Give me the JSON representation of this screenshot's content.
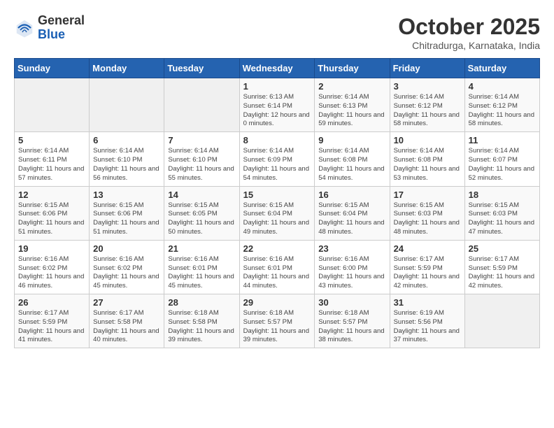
{
  "header": {
    "logo": {
      "general": "General",
      "blue": "Blue"
    },
    "title": "October 2025",
    "location": "Chitradurga, Karnataka, India"
  },
  "calendar": {
    "headers": [
      "Sunday",
      "Monday",
      "Tuesday",
      "Wednesday",
      "Thursday",
      "Friday",
      "Saturday"
    ],
    "weeks": [
      [
        {
          "day": "",
          "sunrise": "",
          "sunset": "",
          "daylight": "",
          "empty": true
        },
        {
          "day": "",
          "sunrise": "",
          "sunset": "",
          "daylight": "",
          "empty": true
        },
        {
          "day": "",
          "sunrise": "",
          "sunset": "",
          "daylight": "",
          "empty": true
        },
        {
          "day": "1",
          "sunrise": "Sunrise: 6:13 AM",
          "sunset": "Sunset: 6:14 PM",
          "daylight": "Daylight: 12 hours and 0 minutes."
        },
        {
          "day": "2",
          "sunrise": "Sunrise: 6:14 AM",
          "sunset": "Sunset: 6:13 PM",
          "daylight": "Daylight: 11 hours and 59 minutes."
        },
        {
          "day": "3",
          "sunrise": "Sunrise: 6:14 AM",
          "sunset": "Sunset: 6:12 PM",
          "daylight": "Daylight: 11 hours and 58 minutes."
        },
        {
          "day": "4",
          "sunrise": "Sunrise: 6:14 AM",
          "sunset": "Sunset: 6:12 PM",
          "daylight": "Daylight: 11 hours and 58 minutes."
        }
      ],
      [
        {
          "day": "5",
          "sunrise": "Sunrise: 6:14 AM",
          "sunset": "Sunset: 6:11 PM",
          "daylight": "Daylight: 11 hours and 57 minutes."
        },
        {
          "day": "6",
          "sunrise": "Sunrise: 6:14 AM",
          "sunset": "Sunset: 6:10 PM",
          "daylight": "Daylight: 11 hours and 56 minutes."
        },
        {
          "day": "7",
          "sunrise": "Sunrise: 6:14 AM",
          "sunset": "Sunset: 6:10 PM",
          "daylight": "Daylight: 11 hours and 55 minutes."
        },
        {
          "day": "8",
          "sunrise": "Sunrise: 6:14 AM",
          "sunset": "Sunset: 6:09 PM",
          "daylight": "Daylight: 11 hours and 54 minutes."
        },
        {
          "day": "9",
          "sunrise": "Sunrise: 6:14 AM",
          "sunset": "Sunset: 6:08 PM",
          "daylight": "Daylight: 11 hours and 54 minutes."
        },
        {
          "day": "10",
          "sunrise": "Sunrise: 6:14 AM",
          "sunset": "Sunset: 6:08 PM",
          "daylight": "Daylight: 11 hours and 53 minutes."
        },
        {
          "day": "11",
          "sunrise": "Sunrise: 6:14 AM",
          "sunset": "Sunset: 6:07 PM",
          "daylight": "Daylight: 11 hours and 52 minutes."
        }
      ],
      [
        {
          "day": "12",
          "sunrise": "Sunrise: 6:15 AM",
          "sunset": "Sunset: 6:06 PM",
          "daylight": "Daylight: 11 hours and 51 minutes."
        },
        {
          "day": "13",
          "sunrise": "Sunrise: 6:15 AM",
          "sunset": "Sunset: 6:06 PM",
          "daylight": "Daylight: 11 hours and 51 minutes."
        },
        {
          "day": "14",
          "sunrise": "Sunrise: 6:15 AM",
          "sunset": "Sunset: 6:05 PM",
          "daylight": "Daylight: 11 hours and 50 minutes."
        },
        {
          "day": "15",
          "sunrise": "Sunrise: 6:15 AM",
          "sunset": "Sunset: 6:04 PM",
          "daylight": "Daylight: 11 hours and 49 minutes."
        },
        {
          "day": "16",
          "sunrise": "Sunrise: 6:15 AM",
          "sunset": "Sunset: 6:04 PM",
          "daylight": "Daylight: 11 hours and 48 minutes."
        },
        {
          "day": "17",
          "sunrise": "Sunrise: 6:15 AM",
          "sunset": "Sunset: 6:03 PM",
          "daylight": "Daylight: 11 hours and 48 minutes."
        },
        {
          "day": "18",
          "sunrise": "Sunrise: 6:15 AM",
          "sunset": "Sunset: 6:03 PM",
          "daylight": "Daylight: 11 hours and 47 minutes."
        }
      ],
      [
        {
          "day": "19",
          "sunrise": "Sunrise: 6:16 AM",
          "sunset": "Sunset: 6:02 PM",
          "daylight": "Daylight: 11 hours and 46 minutes."
        },
        {
          "day": "20",
          "sunrise": "Sunrise: 6:16 AM",
          "sunset": "Sunset: 6:02 PM",
          "daylight": "Daylight: 11 hours and 45 minutes."
        },
        {
          "day": "21",
          "sunrise": "Sunrise: 6:16 AM",
          "sunset": "Sunset: 6:01 PM",
          "daylight": "Daylight: 11 hours and 45 minutes."
        },
        {
          "day": "22",
          "sunrise": "Sunrise: 6:16 AM",
          "sunset": "Sunset: 6:01 PM",
          "daylight": "Daylight: 11 hours and 44 minutes."
        },
        {
          "day": "23",
          "sunrise": "Sunrise: 6:16 AM",
          "sunset": "Sunset: 6:00 PM",
          "daylight": "Daylight: 11 hours and 43 minutes."
        },
        {
          "day": "24",
          "sunrise": "Sunrise: 6:17 AM",
          "sunset": "Sunset: 5:59 PM",
          "daylight": "Daylight: 11 hours and 42 minutes."
        },
        {
          "day": "25",
          "sunrise": "Sunrise: 6:17 AM",
          "sunset": "Sunset: 5:59 PM",
          "daylight": "Daylight: 11 hours and 42 minutes."
        }
      ],
      [
        {
          "day": "26",
          "sunrise": "Sunrise: 6:17 AM",
          "sunset": "Sunset: 5:59 PM",
          "daylight": "Daylight: 11 hours and 41 minutes."
        },
        {
          "day": "27",
          "sunrise": "Sunrise: 6:17 AM",
          "sunset": "Sunset: 5:58 PM",
          "daylight": "Daylight: 11 hours and 40 minutes."
        },
        {
          "day": "28",
          "sunrise": "Sunrise: 6:18 AM",
          "sunset": "Sunset: 5:58 PM",
          "daylight": "Daylight: 11 hours and 39 minutes."
        },
        {
          "day": "29",
          "sunrise": "Sunrise: 6:18 AM",
          "sunset": "Sunset: 5:57 PM",
          "daylight": "Daylight: 11 hours and 39 minutes."
        },
        {
          "day": "30",
          "sunrise": "Sunrise: 6:18 AM",
          "sunset": "Sunset: 5:57 PM",
          "daylight": "Daylight: 11 hours and 38 minutes."
        },
        {
          "day": "31",
          "sunrise": "Sunrise: 6:19 AM",
          "sunset": "Sunset: 5:56 PM",
          "daylight": "Daylight: 11 hours and 37 minutes."
        },
        {
          "day": "",
          "sunrise": "",
          "sunset": "",
          "daylight": "",
          "empty": true
        }
      ]
    ]
  }
}
